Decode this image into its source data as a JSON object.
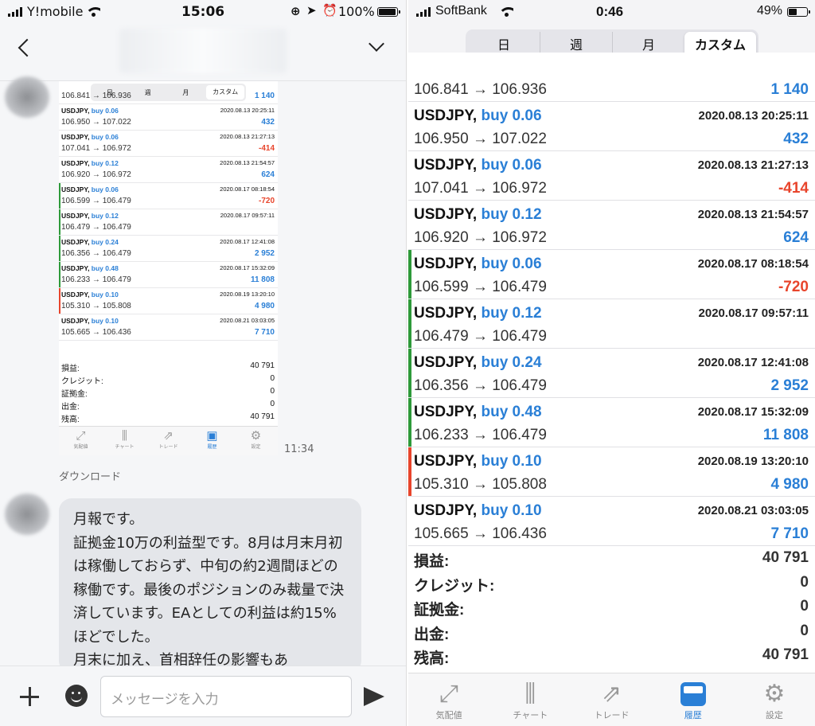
{
  "left": {
    "status": {
      "carrier": "Y!mobile",
      "time": "15:06",
      "battery": "100%",
      "battery_level": 1.0
    },
    "thumbnail": {
      "tabs": [
        "日",
        "週",
        "月",
        "カスタム"
      ],
      "active_tab": 3,
      "trades": [
        {
          "symbol": "USDJPY,",
          "side": "",
          "datetime": "",
          "prices": "106.841 → 106.936",
          "profit": "1 140",
          "color": "#2a7fd6",
          "bar": ""
        },
        {
          "symbol": "USDJPY,",
          "side": "buy 0.06",
          "datetime": "2020.08.13 20:25:11",
          "prices": "106.950 → 107.022",
          "profit": "432",
          "color": "#2a7fd6",
          "bar": ""
        },
        {
          "symbol": "USDJPY,",
          "side": "buy 0.06",
          "datetime": "2020.08.13 21:27:13",
          "prices": "107.041 → 106.972",
          "profit": "-414",
          "color": "#e8452c",
          "bar": ""
        },
        {
          "symbol": "USDJPY,",
          "side": "buy 0.12",
          "datetime": "2020.08.13 21:54:57",
          "prices": "106.920 → 106.972",
          "profit": "624",
          "color": "#2a7fd6",
          "bar": ""
        },
        {
          "symbol": "USDJPY,",
          "side": "buy 0.06",
          "datetime": "2020.08.17 08:18:54",
          "prices": "106.599 → 106.479",
          "profit": "-720",
          "color": "#e8452c",
          "bar": "#2e9a3a"
        },
        {
          "symbol": "USDJPY,",
          "side": "buy 0.12",
          "datetime": "2020.08.17 09:57:11",
          "prices": "106.479 → 106.479",
          "profit": "",
          "color": "#2a7fd6",
          "bar": "#2e9a3a"
        },
        {
          "symbol": "USDJPY,",
          "side": "buy 0.24",
          "datetime": "2020.08.17 12:41:08",
          "prices": "106.356 → 106.479",
          "profit": "2 952",
          "color": "#2a7fd6",
          "bar": "#2e9a3a"
        },
        {
          "symbol": "USDJPY,",
          "side": "buy 0.48",
          "datetime": "2020.08.17 15:32:09",
          "prices": "106.233 → 106.479",
          "profit": "11 808",
          "color": "#2a7fd6",
          "bar": "#2e9a3a"
        },
        {
          "symbol": "USDJPY,",
          "side": "buy 0.10",
          "datetime": "2020.08.19 13:20:10",
          "prices": "105.310 → 105.808",
          "profit": "4 980",
          "color": "#2a7fd6",
          "bar": "#e8452c"
        },
        {
          "symbol": "USDJPY,",
          "side": "buy 0.10",
          "datetime": "2020.08.21 03:03:05",
          "prices": "105.665 → 106.436",
          "profit": "7 710",
          "color": "#2a7fd6",
          "bar": ""
        }
      ],
      "summary": [
        {
          "label": "損益:",
          "value": "40 791"
        },
        {
          "label": "クレジット:",
          "value": "0"
        },
        {
          "label": "証拠金:",
          "value": "0"
        },
        {
          "label": "出金:",
          "value": "0"
        },
        {
          "label": "残高:",
          "value": "40 791"
        }
      ],
      "nav": [
        {
          "glyph": "⤢",
          "label": "気配値"
        },
        {
          "glyph": "⫼",
          "label": "チャート"
        },
        {
          "glyph": "⇗",
          "label": "トレード"
        },
        {
          "glyph": "▣",
          "label": "履歴"
        },
        {
          "glyph": "⚙",
          "label": "設定"
        }
      ],
      "nav_active": 3
    },
    "sent_time": "11:34",
    "download_label": "ダウンロード",
    "message": "月報です。\n証拠金10万の利益型です。8月は月末月初は稼働しておらず、中旬の約2週間ほどの稼働です。最後のポジションのみ裁量で決済しています。EAとしての利益は約15%ほどでした。\n月末に加え、首相辞任の影響もあ",
    "input_placeholder": "メッセージを入力"
  },
  "right": {
    "status": {
      "carrier": "SoftBank",
      "time": "0:46",
      "battery": "49%",
      "battery_level": 0.49
    },
    "tabs": [
      "日",
      "週",
      "月",
      "カスタム"
    ],
    "active_tab": 3,
    "trades": [
      {
        "symbol": "USDJPY,",
        "side": "",
        "datetime": "",
        "prices": "106.841 → 106.936",
        "profit": "1 140",
        "color": "#2a7fd6",
        "bar": ""
      },
      {
        "symbol": "USDJPY,",
        "side": "buy 0.06",
        "datetime": "2020.08.13 20:25:11",
        "prices": "106.950 → 107.022",
        "profit": "432",
        "color": "#2a7fd6",
        "bar": ""
      },
      {
        "symbol": "USDJPY,",
        "side": "buy 0.06",
        "datetime": "2020.08.13 21:27:13",
        "prices": "107.041 → 106.972",
        "profit": "-414",
        "color": "#e8452c",
        "bar": ""
      },
      {
        "symbol": "USDJPY,",
        "side": "buy 0.12",
        "datetime": "2020.08.13 21:54:57",
        "prices": "106.920 → 106.972",
        "profit": "624",
        "color": "#2a7fd6",
        "bar": ""
      },
      {
        "symbol": "USDJPY,",
        "side": "buy 0.06",
        "datetime": "2020.08.17 08:18:54",
        "prices": "106.599 → 106.479",
        "profit": "-720",
        "color": "#e8452c",
        "bar": "#2e9a3a"
      },
      {
        "symbol": "USDJPY,",
        "side": "buy 0.12",
        "datetime": "2020.08.17 09:57:11",
        "prices": "106.479 → 106.479",
        "profit": "",
        "color": "#2a7fd6",
        "bar": "#2e9a3a"
      },
      {
        "symbol": "USDJPY,",
        "side": "buy 0.24",
        "datetime": "2020.08.17 12:41:08",
        "prices": "106.356 → 106.479",
        "profit": "2 952",
        "color": "#2a7fd6",
        "bar": "#2e9a3a"
      },
      {
        "symbol": "USDJPY,",
        "side": "buy 0.48",
        "datetime": "2020.08.17 15:32:09",
        "prices": "106.233 → 106.479",
        "profit": "11 808",
        "color": "#2a7fd6",
        "bar": "#2e9a3a"
      },
      {
        "symbol": "USDJPY,",
        "side": "buy 0.10",
        "datetime": "2020.08.19 13:20:10",
        "prices": "105.310 → 105.808",
        "profit": "4 980",
        "color": "#2a7fd6",
        "bar": "#e8452c"
      },
      {
        "symbol": "USDJPY,",
        "side": "buy 0.10",
        "datetime": "2020.08.21 03:03:05",
        "prices": "105.665 → 106.436",
        "profit": "7 710",
        "color": "#2a7fd6",
        "bar": ""
      }
    ],
    "summary": [
      {
        "label": "損益:",
        "value": "40 791"
      },
      {
        "label": "クレジット:",
        "value": "0"
      },
      {
        "label": "証拠金:",
        "value": "0"
      },
      {
        "label": "出金:",
        "value": "0"
      },
      {
        "label": "残高:",
        "value": "40 791"
      }
    ],
    "nav": [
      {
        "glyph": "⤢",
        "label": "気配値"
      },
      {
        "glyph": "⫼",
        "label": "チャート"
      },
      {
        "glyph": "⇗",
        "label": "トレード"
      },
      {
        "glyph": "",
        "label": "履歴"
      },
      {
        "glyph": "⚙",
        "label": "設定"
      }
    ],
    "nav_active": 3
  },
  "colors": {
    "accent": "#2a7fd6",
    "loss": "#e8452c",
    "group_bar": "#2e9a3a"
  }
}
